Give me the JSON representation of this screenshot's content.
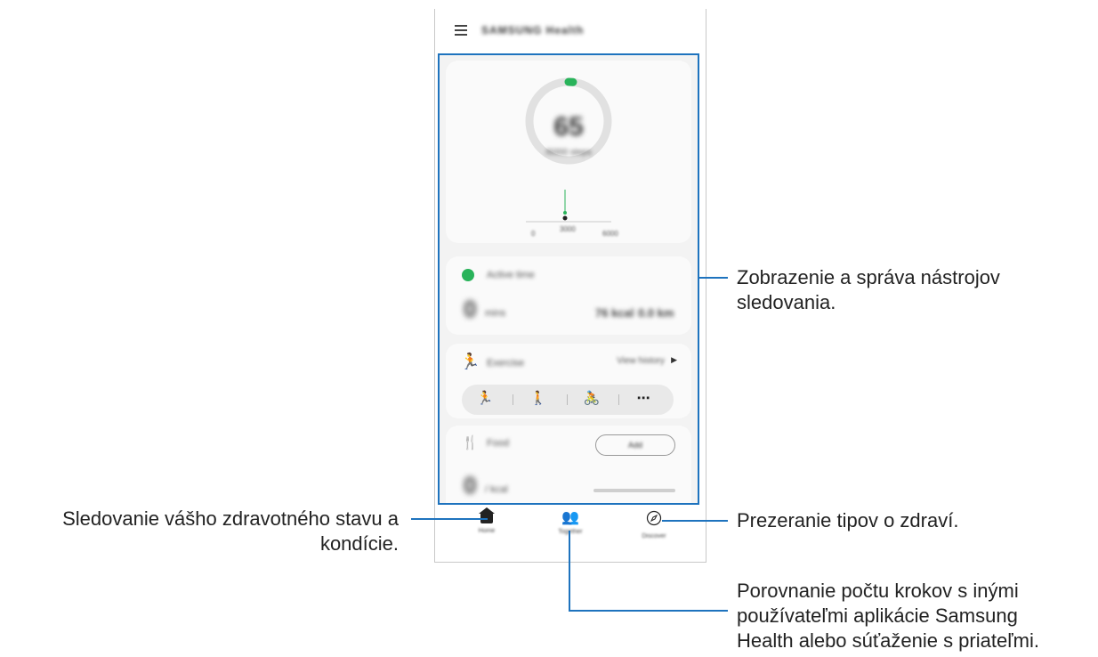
{
  "app": {
    "title": "SAMSUNG Health",
    "menu_icon": "hamburger-icon"
  },
  "steps_card": {
    "steps_value": "65",
    "steps_label": "/6000 steps",
    "chart_ticks": [
      "0",
      "3000",
      "6000"
    ],
    "accent_color": "#29b35a"
  },
  "active_time_card": {
    "title": "Active time",
    "value": "0",
    "unit": "mins",
    "calories": "76 kcal",
    "distance": "0.0 km",
    "icon": "clock-icon"
  },
  "exercise_card": {
    "title": "Exercise",
    "link_label": "View history",
    "activities": [
      "run-icon",
      "walk-icon",
      "cycle-icon",
      "more-icon"
    ]
  },
  "food_card": {
    "title": "Food",
    "button_label": "Add",
    "value": "0",
    "unit": "/ kcal",
    "icon": "fork-knife-icon"
  },
  "bottom_nav": {
    "items": [
      {
        "label": "Home",
        "icon": "home-icon"
      },
      {
        "label": "Together",
        "icon": "people-icon"
      },
      {
        "label": "Discover",
        "icon": "compass-icon"
      }
    ]
  },
  "annotations": {
    "trackers": "Zobrazenie a správa nástrojov\nsledovania.",
    "home": "Sledovanie vášho zdravotného stavu a\nkondície.",
    "discover": "Prezeranie tipov o zdraví.",
    "together": "Porovnanie počtu krokov s inými\npoužívateľmi aplikácie Samsung\nHealth alebo súťaženie s priateľmi."
  },
  "colors": {
    "highlight_border": "#1e73be",
    "callout_line": "#1e73be"
  }
}
